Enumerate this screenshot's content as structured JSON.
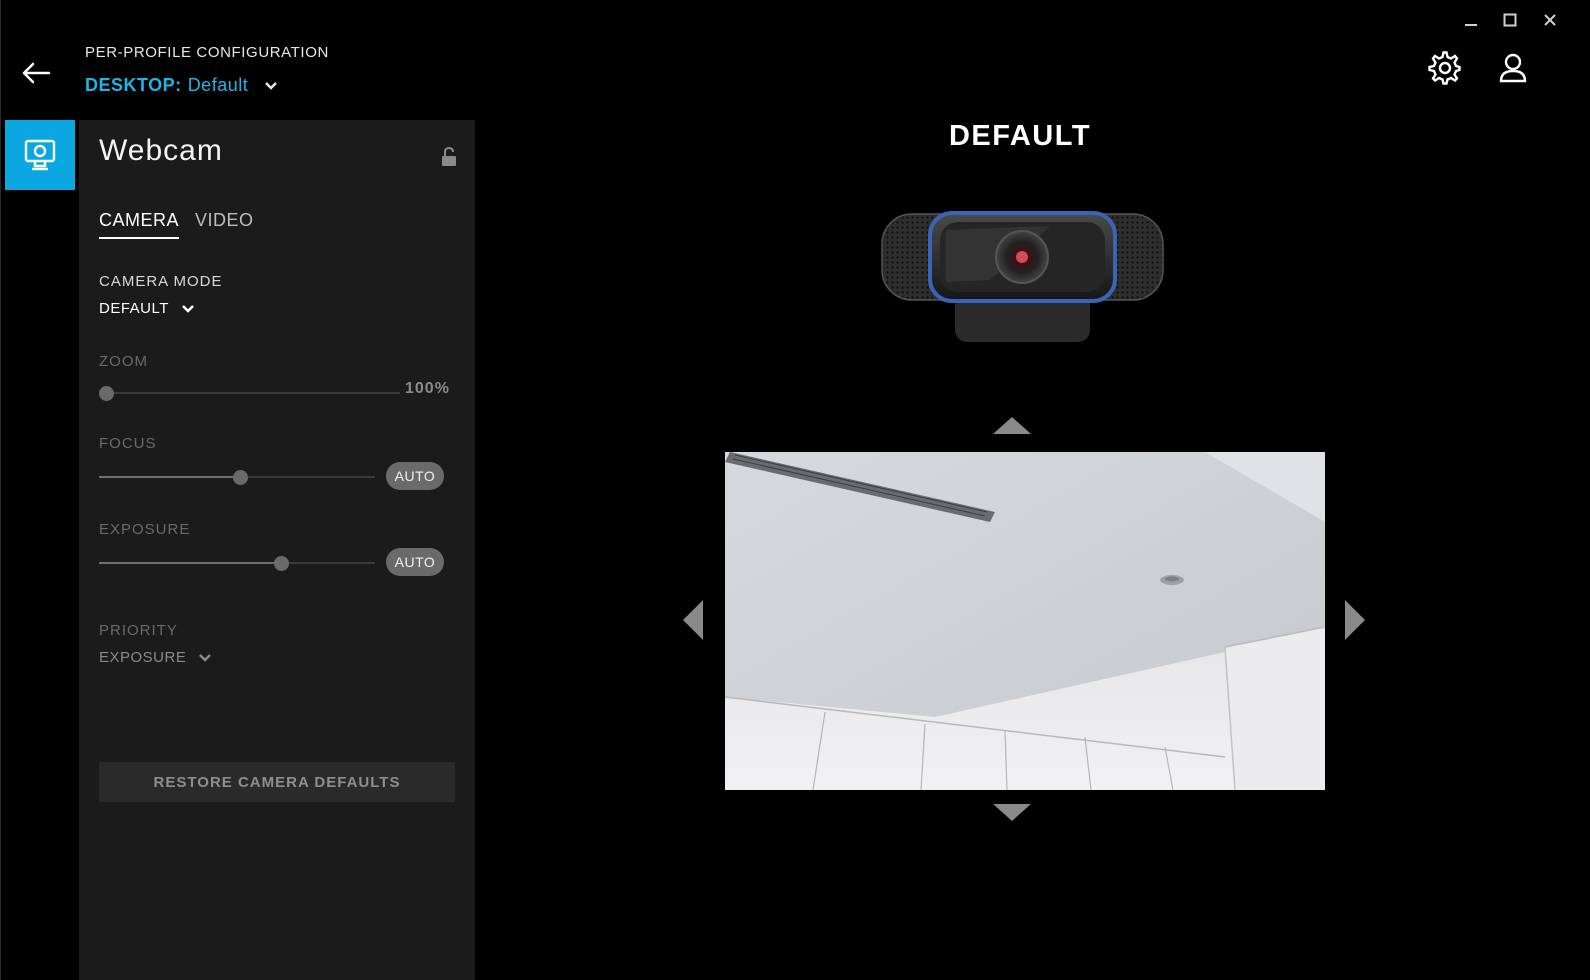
{
  "window": {
    "minimize_icon": "minimize-icon",
    "maximize_icon": "maximize-icon",
    "close_icon": "close-icon"
  },
  "header": {
    "caption": "PER-PROFILE CONFIGURATION",
    "profile_prefix": "DESKTOP:",
    "profile_name": "Default",
    "accent_color": "#1eb6e6"
  },
  "rail": {
    "active_item": "webcam",
    "active_color": "#0ba7e1"
  },
  "panel": {
    "title": "Webcam",
    "tabs": [
      {
        "label": "CAMERA",
        "active": true
      },
      {
        "label": "VIDEO",
        "active": false
      }
    ],
    "camera_mode": {
      "label": "CAMERA MODE",
      "value": "DEFAULT"
    },
    "zoom": {
      "label": "ZOOM",
      "value_text": "100%",
      "level": 0.0
    },
    "focus": {
      "label": "FOCUS",
      "auto_label": "AUTO",
      "level": 0.51
    },
    "exposure": {
      "label": "EXPOSURE",
      "auto_label": "AUTO",
      "level": 0.66
    },
    "priority": {
      "label": "PRIORITY",
      "value": "EXPOSURE"
    },
    "restore_label": "RESTORE CAMERA DEFAULTS"
  },
  "main": {
    "mode_title": "DEFAULT"
  }
}
